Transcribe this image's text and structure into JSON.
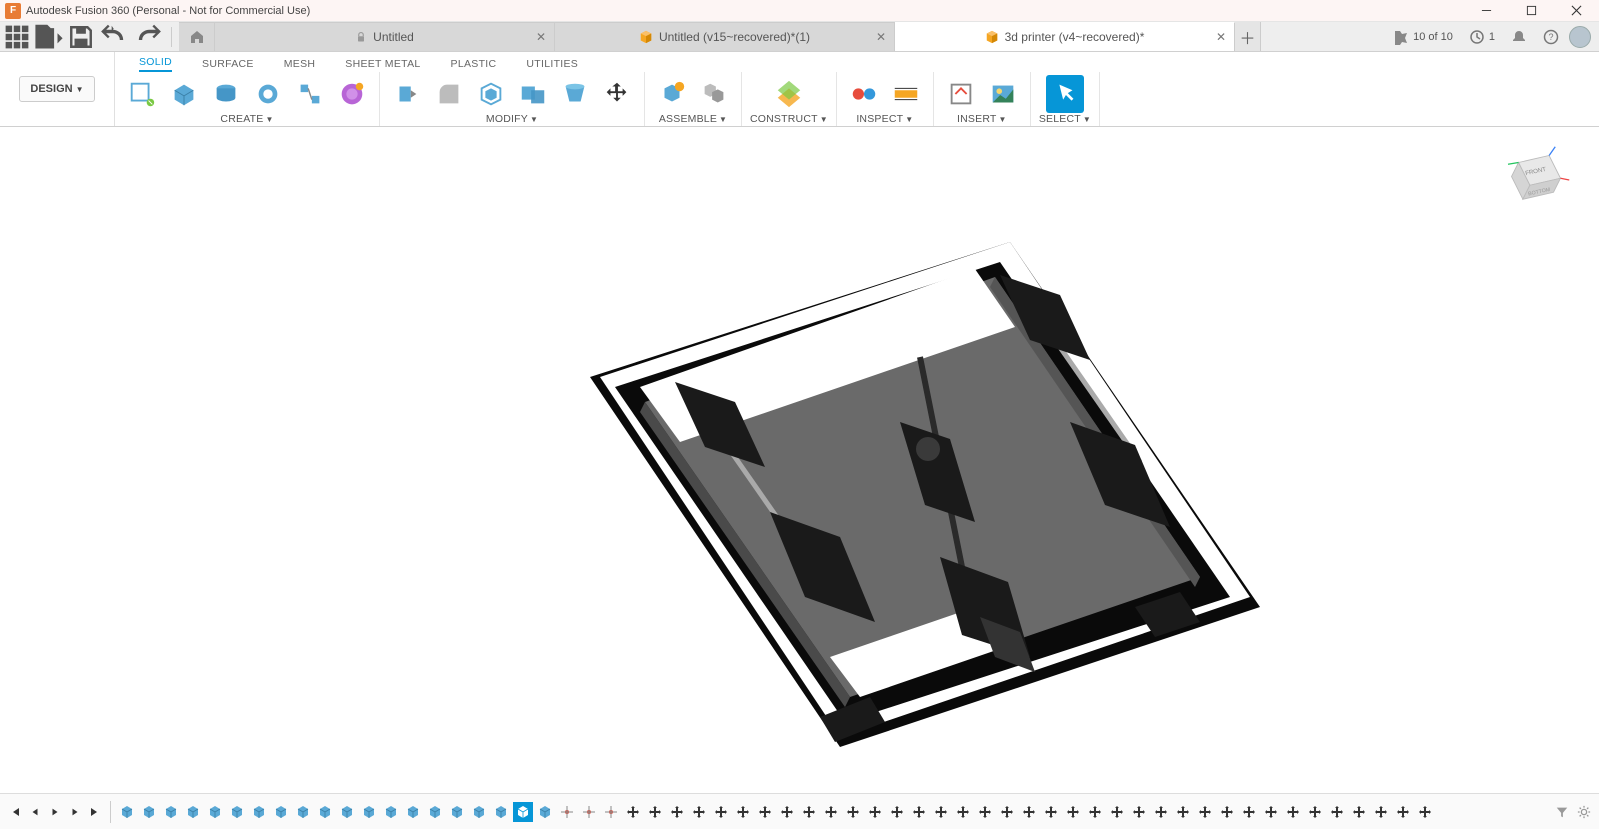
{
  "window": {
    "title": "Autodesk Fusion 360 (Personal - Not for Commercial Use)"
  },
  "tabs": [
    {
      "label": "Untitled",
      "icon": "lock",
      "active": false
    },
    {
      "label": "Untitled (v15~recovered)*(1)",
      "icon": "cube",
      "active": false
    },
    {
      "label": "3d printer (v4~recovered)*",
      "icon": "cube",
      "active": true
    }
  ],
  "status": {
    "jobs": "10 of 10",
    "clock": "1"
  },
  "workspace": {
    "label": "DESIGN"
  },
  "ribbon_tabs": [
    "SOLID",
    "SURFACE",
    "MESH",
    "SHEET METAL",
    "PLASTIC",
    "UTILITIES"
  ],
  "panels": {
    "create": "CREATE",
    "modify": "MODIFY",
    "assemble": "ASSEMBLE",
    "construct": "CONSTRUCT",
    "inspect": "INSPECT",
    "insert": "INSERT",
    "select": "SELECT"
  },
  "viewcube": {
    "face": "FRONT",
    "bottom": "BOTTOM"
  },
  "timeline": {
    "count": 60
  }
}
